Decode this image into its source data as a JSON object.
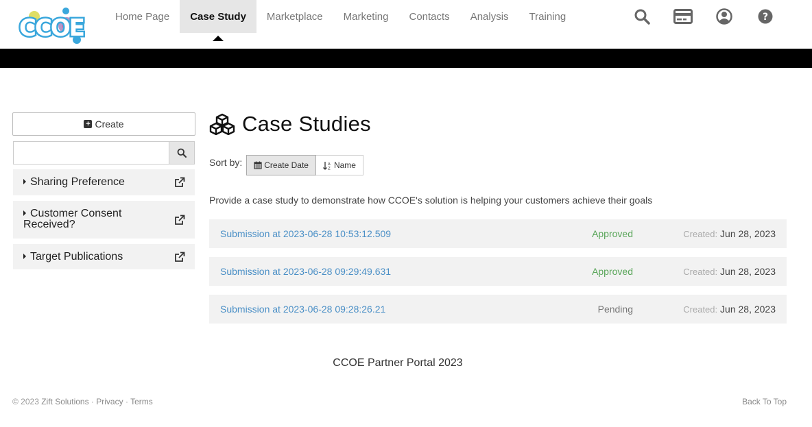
{
  "header": {
    "logo_text": "CCOE",
    "nav": [
      {
        "label": "Home Page",
        "active": false
      },
      {
        "label": "Case Study",
        "active": true
      },
      {
        "label": "Marketplace",
        "active": false
      },
      {
        "label": "Marketing",
        "active": false
      },
      {
        "label": "Contacts",
        "active": false
      },
      {
        "label": "Analysis",
        "active": false
      },
      {
        "label": "Training",
        "active": false
      }
    ],
    "icons": [
      "search-icon",
      "credit-card-icon",
      "user-icon",
      "help-icon"
    ]
  },
  "sidebar": {
    "create_label": "Create",
    "search_value": "",
    "filters": [
      {
        "label": "Sharing Preference"
      },
      {
        "label": "Customer Consent Received?"
      },
      {
        "label": "Target Publications"
      }
    ]
  },
  "main": {
    "title": "Case Studies",
    "sort_label": "Sort by:",
    "sort_options": [
      {
        "label": "Create Date",
        "active": true
      },
      {
        "label": "Name",
        "active": false
      }
    ],
    "description": "Provide a case study to demonstrate how CCOE's solution is helping your customers achieve their goals",
    "created_label": "Created:",
    "submissions": [
      {
        "title": "Submission at 2023-06-28 10:53:12.509",
        "status": "Approved",
        "date": "Jun 28, 2023"
      },
      {
        "title": "Submission at 2023-06-28 09:29:49.631",
        "status": "Approved",
        "date": "Jun 28, 2023"
      },
      {
        "title": "Submission at 2023-06-28 09:28:26.21",
        "status": "Pending",
        "date": "Jun 28, 2023"
      }
    ]
  },
  "footer": {
    "portal_text": "CCOE Partner Portal 2023",
    "copyright": "© 2023 ",
    "company": "Zift Solutions",
    "sep": " · ",
    "privacy": "Privacy",
    "terms": "Terms",
    "back_to_top": "Back To Top"
  },
  "colors": {
    "link": "#4a8fc6",
    "approved": "#5aa65a",
    "pending": "#777777",
    "logo_blue": "#3aa7dc",
    "logo_yellow": "#d8d84a",
    "logo_purple": "#7b3f96",
    "logo_pink": "#e23b8b"
  }
}
